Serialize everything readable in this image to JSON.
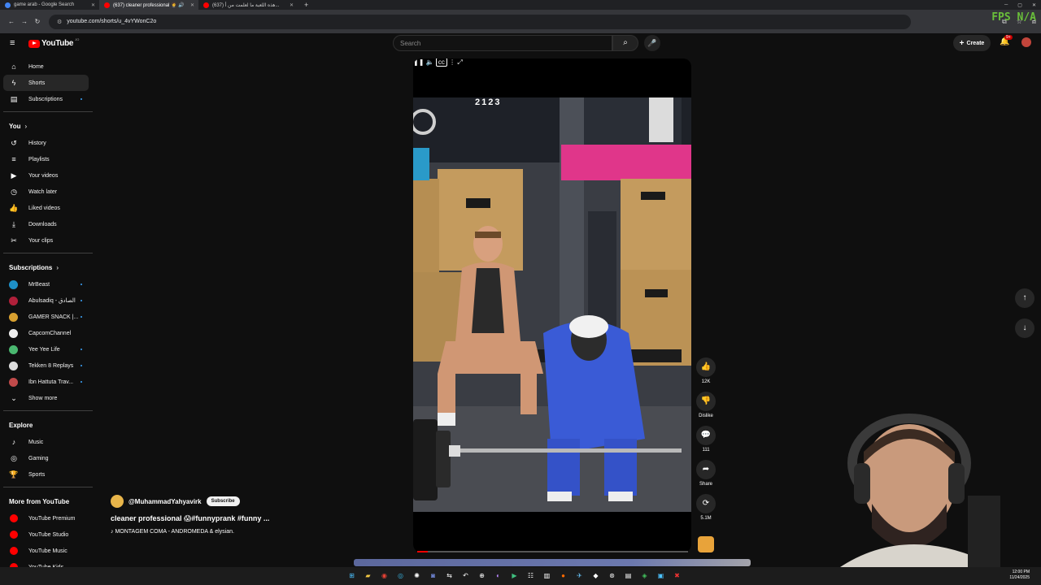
{
  "browser": {
    "tabs": [
      {
        "title": "game arab - Google Search",
        "color": "#4285f4",
        "active": false
      },
      {
        "title": "(637) cleaner professional 🤵 🔊",
        "color": "#ff0000",
        "active": true
      },
      {
        "title": "(637) هذه اللعبة ما لعلمت من أ...",
        "color": "#ff0000",
        "active": false
      }
    ],
    "url": "youtube.com/shorts/u_4vYWonC2o",
    "overlay_text": "FPS N/A"
  },
  "header": {
    "logo_text": "YouTube",
    "logo_country": "JO",
    "search_placeholder": "Search",
    "create_label": "Create",
    "notification_badge": "9+"
  },
  "sidebar": {
    "main": [
      {
        "label": "Home",
        "icon": "home-icon",
        "glyph": "⌂"
      },
      {
        "label": "Shorts",
        "icon": "shorts-icon",
        "glyph": "ϟ",
        "active": true
      },
      {
        "label": "Subscriptions",
        "icon": "subscriptions-icon",
        "glyph": "▤",
        "dot": true
      }
    ],
    "you_heading": "You",
    "you": [
      {
        "label": "History",
        "icon": "history-icon",
        "glyph": "↺"
      },
      {
        "label": "Playlists",
        "icon": "playlists-icon",
        "glyph": "≡"
      },
      {
        "label": "Your videos",
        "icon": "your-videos-icon",
        "glyph": "▶"
      },
      {
        "label": "Watch later",
        "icon": "watch-later-icon",
        "glyph": "◷"
      },
      {
        "label": "Liked videos",
        "icon": "liked-videos-icon",
        "glyph": "👍"
      },
      {
        "label": "Downloads",
        "icon": "downloads-icon",
        "glyph": "⤓"
      },
      {
        "label": "Your clips",
        "icon": "clips-icon",
        "glyph": "✂"
      }
    ],
    "subscriptions_heading": "Subscriptions",
    "subscriptions": [
      {
        "label": "MrBeast",
        "color": "#1e90c8",
        "dot": true
      },
      {
        "label": "Abulsadiq - الصادق",
        "color": "#b0203a",
        "dot": true
      },
      {
        "label": "GAMER SNACK |...",
        "color": "#d8a030",
        "dot": true
      },
      {
        "label": "CapcomChannel",
        "color": "#eeeeee",
        "dot": false
      },
      {
        "label": "Yee Yee Life",
        "color": "#4ab870",
        "dot": true
      },
      {
        "label": "Tekken 8 Replays",
        "color": "#dddddd",
        "dot": true
      },
      {
        "label": "Ibn Hattuta Trav...",
        "color": "#c04a4a",
        "dot": true
      }
    ],
    "show_more": "Show more",
    "explore_heading": "Explore",
    "explore": [
      {
        "label": "Music",
        "icon": "music-icon",
        "glyph": "♪"
      },
      {
        "label": "Gaming",
        "icon": "gaming-icon",
        "glyph": "◎"
      },
      {
        "label": "Sports",
        "icon": "sports-icon",
        "glyph": "🏆"
      }
    ],
    "more_heading": "More from YouTube",
    "more": [
      {
        "label": "YouTube Premium"
      },
      {
        "label": "YouTube Studio"
      },
      {
        "label": "YouTube Music"
      },
      {
        "label": "YouTube Kids"
      }
    ]
  },
  "short": {
    "counter": "2123",
    "channel": "@MuhammadYahyavirk",
    "subscribe_label": "Subscribe",
    "title": "cleaner professional 😱#funnyprank #funny ...",
    "music": "♪ MONTAGEM COMA - ANDROMEDA & elysian.",
    "progress": 0.04,
    "actions": [
      {
        "name": "like-button",
        "glyph": "👍",
        "label": "12K"
      },
      {
        "name": "dislike-button",
        "glyph": "👎",
        "label": "Dislike"
      },
      {
        "name": "comments-button",
        "glyph": "💬",
        "label": "111"
      },
      {
        "name": "share-button",
        "glyph": "➦",
        "label": "Share"
      },
      {
        "name": "remix-button",
        "glyph": "⟳",
        "label": "5.1M"
      }
    ]
  },
  "taskbar": {
    "time": "12:00 PM",
    "date": "11/24/2025"
  }
}
